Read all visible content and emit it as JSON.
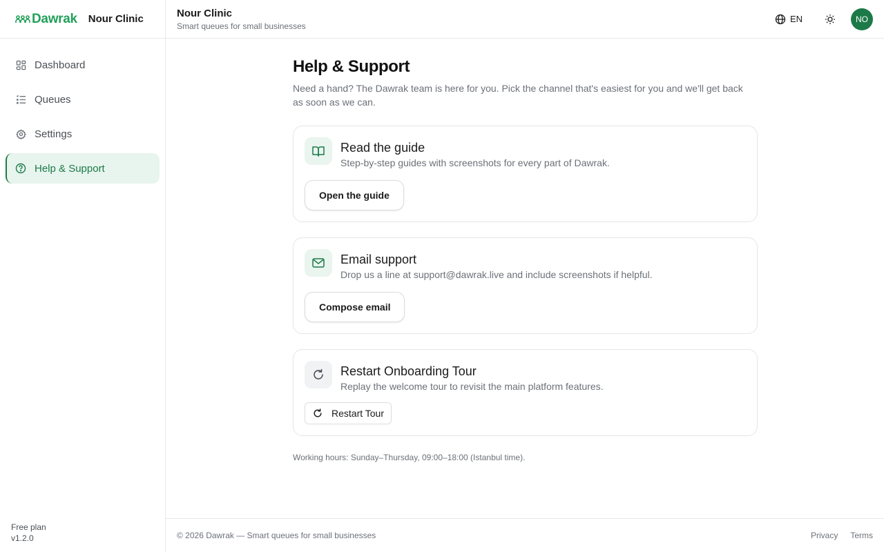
{
  "brand": {
    "logo_text": "Dawrak",
    "clinic_name": "Nour Clinic"
  },
  "colors": {
    "accent": "#1c7a48",
    "logo": "#22a05a",
    "active_bg": "#e8f4ee"
  },
  "sidebar": {
    "items": [
      {
        "label": "Dashboard",
        "icon": "grid-icon"
      },
      {
        "label": "Queues",
        "icon": "list-icon"
      },
      {
        "label": "Settings",
        "icon": "gear-icon"
      },
      {
        "label": "Help & Support",
        "icon": "help-circle-icon",
        "active": true
      }
    ],
    "plan": "Free plan",
    "version": "v1.2.0"
  },
  "header": {
    "title": "Nour Clinic",
    "subtitle": "Smart queues for small businesses",
    "language": "EN",
    "avatar_initials": "NO"
  },
  "main": {
    "title": "Help & Support",
    "description": "Need a hand? The Dawrak team is here for you. Pick the channel that's easiest for you and we'll get back as soon as we can.",
    "cards": [
      {
        "title": "Read the guide",
        "description": "Step-by-step guides with screenshots for every part of Dawrak.",
        "button": "Open the guide",
        "icon": "book-icon"
      },
      {
        "title": "Email support",
        "description": "Drop us a line at support@dawrak.live and include screenshots if helpful.",
        "button": "Compose email",
        "icon": "mail-icon"
      },
      {
        "title": "Restart Onboarding Tour",
        "description": "Replay the welcome tour to revisit the main platform features.",
        "button": "Restart Tour",
        "icon": "refresh-icon"
      }
    ],
    "hours": "Working hours: Sunday–Thursday, 09:00–18:00 (Istanbul time)."
  },
  "footer": {
    "copyright": "© 2026 Dawrak — Smart queues for small businesses",
    "links": [
      "Privacy",
      "Terms"
    ]
  }
}
